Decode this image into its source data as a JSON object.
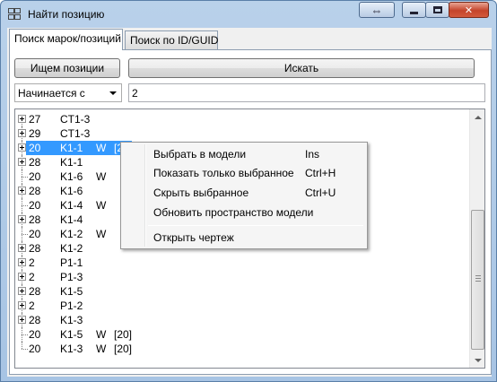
{
  "window": {
    "title": "Найти позицию"
  },
  "tabs": [
    {
      "label": "Поиск марок/позиций"
    },
    {
      "label": "Поиск по ID/GUID"
    }
  ],
  "toolbar": {
    "search_positions_label": "Ищем позиции",
    "search_label": "Искать"
  },
  "filter": {
    "mode_value": "Начинается с",
    "query_value": "2"
  },
  "tree": {
    "rows": [
      {
        "c1": "27",
        "c2": "CT1-3",
        "c3": "",
        "c4": "",
        "expandable": true
      },
      {
        "c1": "29",
        "c2": "CT1-3",
        "c3": "",
        "c4": "",
        "expandable": true
      },
      {
        "c1": "20",
        "c2": "K1-1",
        "c3": "W",
        "c4": "[20]",
        "expandable": true,
        "selected": true
      },
      {
        "c1": "28",
        "c2": "K1-1",
        "c3": "",
        "c4": "",
        "expandable": true
      },
      {
        "c1": "20",
        "c2": "K1-6",
        "c3": "W",
        "c4": "",
        "expandable": false
      },
      {
        "c1": "28",
        "c2": "K1-6",
        "c3": "",
        "c4": "",
        "expandable": true
      },
      {
        "c1": "20",
        "c2": "K1-4",
        "c3": "W",
        "c4": "",
        "expandable": false
      },
      {
        "c1": "28",
        "c2": "K1-4",
        "c3": "",
        "c4": "",
        "expandable": true
      },
      {
        "c1": "20",
        "c2": "K1-2",
        "c3": "W",
        "c4": "",
        "expandable": false
      },
      {
        "c1": "28",
        "c2": "K1-2",
        "c3": "",
        "c4": "",
        "expandable": true
      },
      {
        "c1": "2",
        "c2": "P1-1",
        "c3": "",
        "c4": "",
        "expandable": true
      },
      {
        "c1": "2",
        "c2": "P1-3",
        "c3": "",
        "c4": "",
        "expandable": true
      },
      {
        "c1": "28",
        "c2": "K1-5",
        "c3": "",
        "c4": "",
        "expandable": true
      },
      {
        "c1": "2",
        "c2": "P1-2",
        "c3": "",
        "c4": "",
        "expandable": true
      },
      {
        "c1": "28",
        "c2": "K1-3",
        "c3": "",
        "c4": "",
        "expandable": true
      },
      {
        "c1": "20",
        "c2": "K1-5",
        "c3": "W",
        "c4": "[20]",
        "expandable": false
      },
      {
        "c1": "20",
        "c2": "K1-3",
        "c3": "W",
        "c4": "[20]",
        "expandable": false
      }
    ]
  },
  "context_menu": {
    "items": [
      {
        "label": "Выбрать в модели",
        "shortcut": "Ins"
      },
      {
        "label": "Показать только выбранное",
        "shortcut": "Ctrl+H"
      },
      {
        "label": "Скрыть выбранное",
        "shortcut": "Ctrl+U"
      },
      {
        "label": "Обновить пространство модели",
        "shortcut": ""
      },
      {
        "label": "Открыть чертеж",
        "shortcut": ""
      }
    ]
  },
  "colors": {
    "selection": "#3399ff",
    "titlebar": "#b9d1ea",
    "close_button": "#c4442b"
  }
}
